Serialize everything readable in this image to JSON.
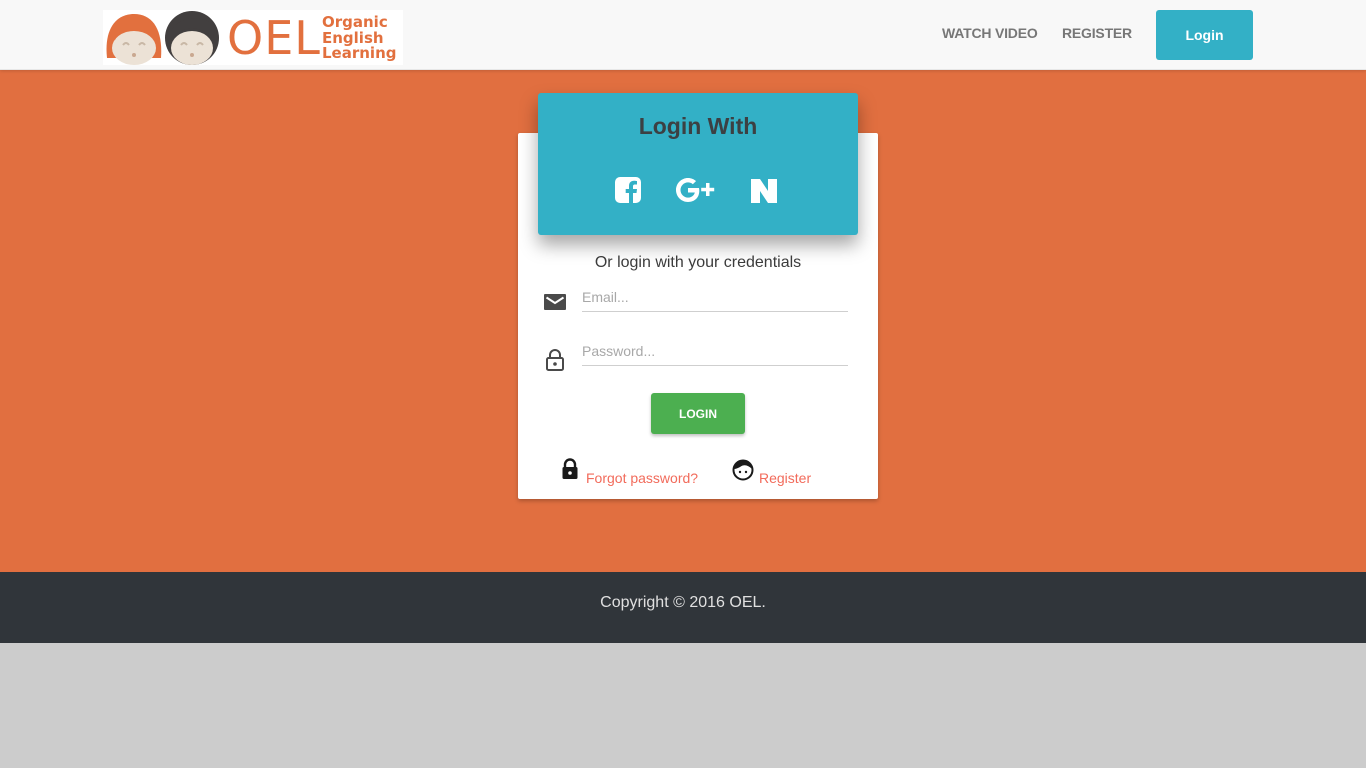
{
  "brand": {
    "logo_text": "OEL",
    "logo_subtitle": [
      "Organic",
      "English",
      "Learning"
    ],
    "color": "#e2703e"
  },
  "nav": {
    "links": [
      {
        "label": "WATCH VIDEO"
      },
      {
        "label": "REGISTER"
      }
    ],
    "login_label": "Login",
    "login_color": "#33b0c6"
  },
  "login_card": {
    "header_title": "Login With",
    "social": [
      {
        "name": "facebook",
        "icon": "facebook-icon"
      },
      {
        "name": "google-plus",
        "icon": "google-plus-icon"
      },
      {
        "name": "naver",
        "icon": "naver-n-icon"
      }
    ],
    "subtitle": "Or login with your credentials",
    "email": {
      "placeholder": "Email...",
      "value": "",
      "icon": "mail-icon"
    },
    "password": {
      "placeholder": "Password...",
      "value": "",
      "icon": "lock-icon"
    },
    "submit_label": "LOGIN",
    "forgot_label": "Forgot password?",
    "register_label": "Register"
  },
  "colors": {
    "hero_bg": "#e16f40",
    "footer_bg": "#30353a",
    "submit": "#4caf50",
    "link": "#f26b5b"
  },
  "footer": {
    "copyright": "Copyright © 2016 OEL."
  }
}
